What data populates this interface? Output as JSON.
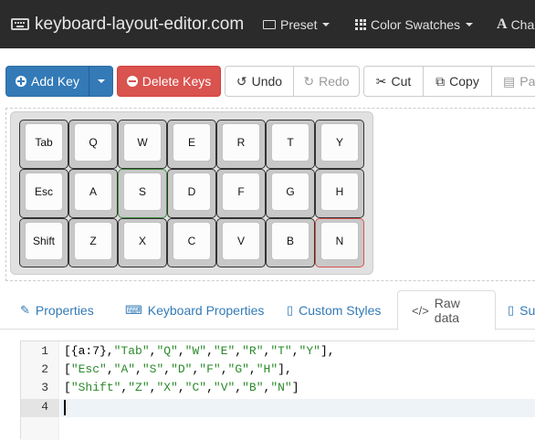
{
  "navbar": {
    "brand": "keyboard-layout-editor.com",
    "preset": "Preset",
    "color_swatches": "Color Swatches",
    "character_picker": "Cha"
  },
  "toolbar": {
    "add_key": "Add Key",
    "delete_keys": "Delete Keys",
    "undo": "Undo",
    "redo": "Redo",
    "cut": "Cut",
    "copy": "Copy",
    "paste": "Pas"
  },
  "keyboard": {
    "rows": [
      [
        "Tab",
        "Q",
        "W",
        "E",
        "R",
        "T",
        "Y"
      ],
      [
        "Esc",
        "A",
        "S",
        "D",
        "F",
        "G",
        "H"
      ],
      [
        "Shift",
        "Z",
        "X",
        "C",
        "V",
        "B",
        "N"
      ]
    ],
    "selected_key": "N",
    "selection_color": "#d9534f",
    "hover_color": "#3c8c3c"
  },
  "tabs": {
    "properties": "Properties",
    "keyboard_properties": "Keyboard Properties",
    "custom_styles": "Custom Styles",
    "raw_data": "Raw data",
    "summary": "Su",
    "active": "Raw data"
  },
  "editor": {
    "line_numbers": [
      "1",
      "2",
      "3",
      "4"
    ],
    "lines": [
      "[{a:7},\"Tab\",\"Q\",\"W\",\"E\",\"R\",\"T\",\"Y\"],",
      "[\"Esc\",\"A\",\"S\",\"D\",\"F\",\"G\",\"H\"],",
      "[\"Shift\",\"Z\",\"X\",\"C\",\"V\",\"B\",\"N\"]",
      ""
    ]
  },
  "colors": {
    "navbar_bg": "#2b2b2b",
    "primary": "#337ab7",
    "danger": "#d9534f",
    "string_token": "#2a8a2a"
  }
}
